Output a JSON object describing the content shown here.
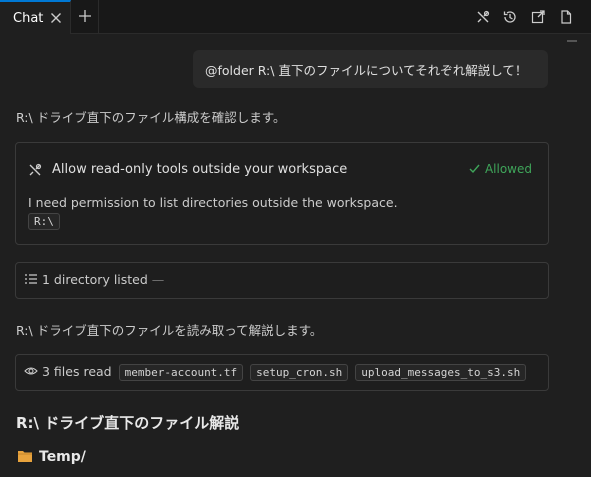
{
  "tabs": {
    "active_label": "Chat"
  },
  "toolbar": {
    "icons": [
      "tools-icon",
      "history-icon",
      "open-in-editor-icon",
      "new-file-icon"
    ]
  },
  "user_message": "@folder R:\\ 直下のファイルについてそれぞれ解説して！",
  "assistant": {
    "intro": "R:\\ ドライブ直下のファイル構成を確認します。",
    "permission": {
      "title": "Allow read-only tools outside your workspace",
      "status": "Allowed",
      "description": "I need permission to list directories outside the workspace.",
      "path": "R:\\"
    },
    "listing": {
      "text": "1 directory listed",
      "suffix": "—"
    },
    "reading_intro": "R:\\ ドライブ直下のファイルを読み取って解説します。",
    "files_read": {
      "label": "3 files read",
      "files": [
        "member-account.tf",
        "setup_cron.sh",
        "upload_messages_to_s3.sh"
      ]
    },
    "heading": "R:\\ ドライブ直下のファイル解説",
    "folder": "Temp/"
  },
  "colors": {
    "accent": "#0078d4",
    "allowed": "#3fa55a",
    "folder": "#e8a33d"
  }
}
